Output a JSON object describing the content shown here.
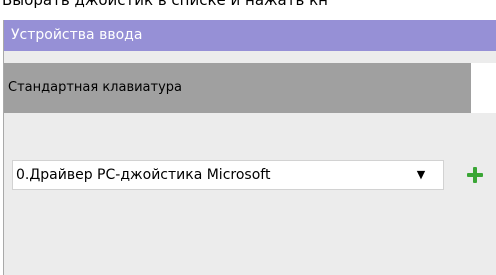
{
  "instruction_caption": "Выбрать джойстик в списке и нажать кн",
  "panel": {
    "title": "Устройства ввода"
  },
  "tabs": [
    {
      "label": "Стандартная клавиатура",
      "active": true
    }
  ],
  "device_select": {
    "value": "0.Драйвер PC-джойстика Microsoft",
    "arrow_icon": "dropdown-arrow-icon"
  },
  "add_button": {
    "icon": "plus-icon",
    "color": "#3aa635"
  },
  "colors": {
    "header_bg": "#9690d6",
    "tab_active_bg": "#a0a0a0",
    "panel_bg": "#ececec"
  }
}
